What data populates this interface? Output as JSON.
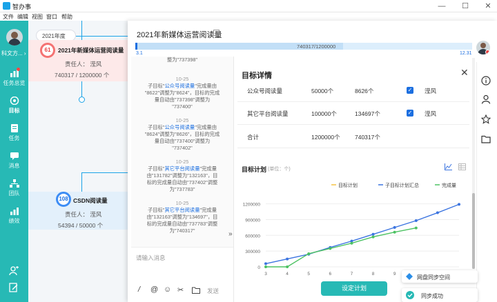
{
  "app": {
    "name": "智办事"
  },
  "window_controls": {
    "minimize": "—",
    "maximize": "☐",
    "close": "✕"
  },
  "menu": [
    "文件",
    "编辑",
    "视图",
    "窗口",
    "帮助"
  ],
  "sidebar": {
    "user_label": "科文方...",
    "user_chevron": "›",
    "items": [
      {
        "label": "任务总览",
        "icon": "bar-chart-icon",
        "badge": true
      },
      {
        "label": "目标",
        "icon": "target-icon",
        "active": true
      },
      {
        "label": "任务",
        "icon": "list-icon"
      },
      {
        "label": "消息",
        "icon": "chat-icon"
      },
      {
        "label": "团队",
        "icon": "org-icon"
      },
      {
        "label": "绩效",
        "icon": "stats-icon"
      }
    ],
    "bottom_icons": [
      "add-user-icon",
      "edit-note-icon"
    ]
  },
  "canvas": {
    "year": "2021年度",
    "cards": [
      {
        "ring_value": "61",
        "title": "2021年新媒体运营阅读量",
        "owner": "责任人：  滢风",
        "progress": "740317 / 1200000 个",
        "ring_color": "#f47272"
      },
      {
        "ring_value": "108",
        "title": "CSDN阅读量",
        "owner": "责任人：  滢风",
        "progress": "54394 / 50000 个",
        "ring_color": "#3d8df5"
      }
    ]
  },
  "panel": {
    "title": "2021年新媒体运营阅读量",
    "progress_text": "740317/1200000",
    "progress_fraction": 0.617,
    "date_start": "3.1",
    "date_end": "12.31"
  },
  "activity": [
    {
      "lines": [
        "整为\"737398\""
      ],
      "partial": true
    },
    {
      "date": "10-25",
      "prefix": "子目标\"",
      "tag": "公众号阅读量",
      "rest": [
        "\"完成量由",
        "\"8622\"调整为\"8624\"，目标的完成",
        "量自动由\"737398\"调整为",
        "\"737400\""
      ]
    },
    {
      "date": "10-25",
      "prefix": "子目标\"",
      "tag": "公众号阅读量",
      "rest": [
        "\"完成量由",
        "\"8624\"调整为\"8626\"，目标的完成",
        "量自动由\"737400\"调整为",
        "\"737402\""
      ]
    },
    {
      "date": "10-25",
      "prefix": "子目标\"",
      "tag": "其它平台阅读量",
      "rest": [
        "\"完成量",
        "由\"131782\"调整为\"132163\"，目",
        "标的完成量自动由\"737402\"调整",
        "为\"737783\""
      ]
    },
    {
      "date": "10-25",
      "prefix": "子目标\"",
      "tag": "其它平台阅读量",
      "rest": [
        "\"完成量",
        "由\"132163\"调整为\"134697\"，目",
        "标的完成量自动由\"737783\"调整",
        "为\"740317\""
      ]
    }
  ],
  "message": {
    "placeholder": "请输入消息",
    "send": "发送",
    "collapse": "»"
  },
  "detail": {
    "title": "目标详情",
    "close": "✕",
    "rows": [
      {
        "name": "公众号阅读量",
        "target": "50000个",
        "done": "8626个",
        "checked": true,
        "owner": "滢风"
      },
      {
        "name": "其它平台阅读量",
        "target": "100000个",
        "done": "134697个",
        "checked": true,
        "owner": "滢风"
      },
      {
        "name": "合计",
        "target": "1200000个",
        "done": "740317个"
      }
    ]
  },
  "plan": {
    "title": "目标计划",
    "unit": "(单位：个)",
    "button": "设定计划"
  },
  "chart_data": {
    "type": "line",
    "x": [
      3,
      4,
      5,
      6,
      7,
      8,
      9,
      10,
      11,
      12
    ],
    "ylim": [
      0,
      1300000
    ],
    "yticks": [
      "0",
      "300000",
      "600000",
      "900000",
      "1200000"
    ],
    "legend_position": "top-right",
    "series": [
      {
        "name": "目标计划",
        "color": "#f5c242",
        "values": []
      },
      {
        "name": "子目标计划汇总",
        "color": "#3b74e0",
        "values": [
          60000,
          150000,
          240000,
          370000,
          490000,
          620000,
          750000,
          880000,
          1030000,
          1190000
        ]
      },
      {
        "name": "完成量",
        "color": "#4cc262",
        "values": [
          0,
          0,
          250000,
          350000,
          450000,
          570000,
          660000,
          740317,
          null,
          null
        ]
      }
    ]
  },
  "right_rail": [
    "info-icon",
    "person-icon",
    "star-icon",
    "folder-icon"
  ],
  "toasts": [
    {
      "text": "网盘同步空间",
      "icon": "sync-icon"
    },
    {
      "text": "同步成功",
      "icon": "check-circle-icon"
    }
  ]
}
